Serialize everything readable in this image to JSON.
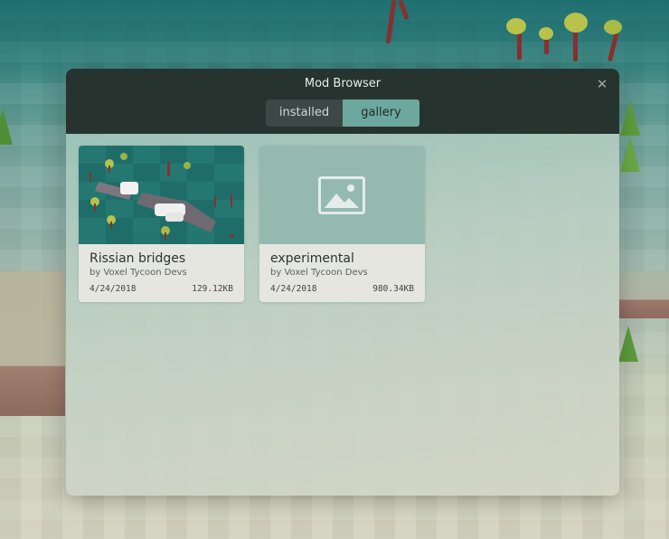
{
  "window": {
    "title": "Mod Browser",
    "close_icon": "close-icon"
  },
  "tabs": [
    {
      "label": "installed",
      "active": false
    },
    {
      "label": "gallery",
      "active": true
    }
  ],
  "mods": [
    {
      "name": "Rissian bridges",
      "author": "by Voxel Tycoon Devs",
      "date": "4/24/2018",
      "size": "129.12KB",
      "thumbnail": "bridge-scene-thumbnail"
    },
    {
      "name": "experimental",
      "author": "by Voxel Tycoon Devs",
      "date": "4/24/2018",
      "size": "980.34KB",
      "thumbnail": "image-placeholder-icon"
    }
  ],
  "colors": {
    "header": "#27332f",
    "tab_active": "#6ca89d",
    "tab_inactive": "#3c4845",
    "card": "#e6e6e0",
    "placeholder": "#94bab0"
  }
}
